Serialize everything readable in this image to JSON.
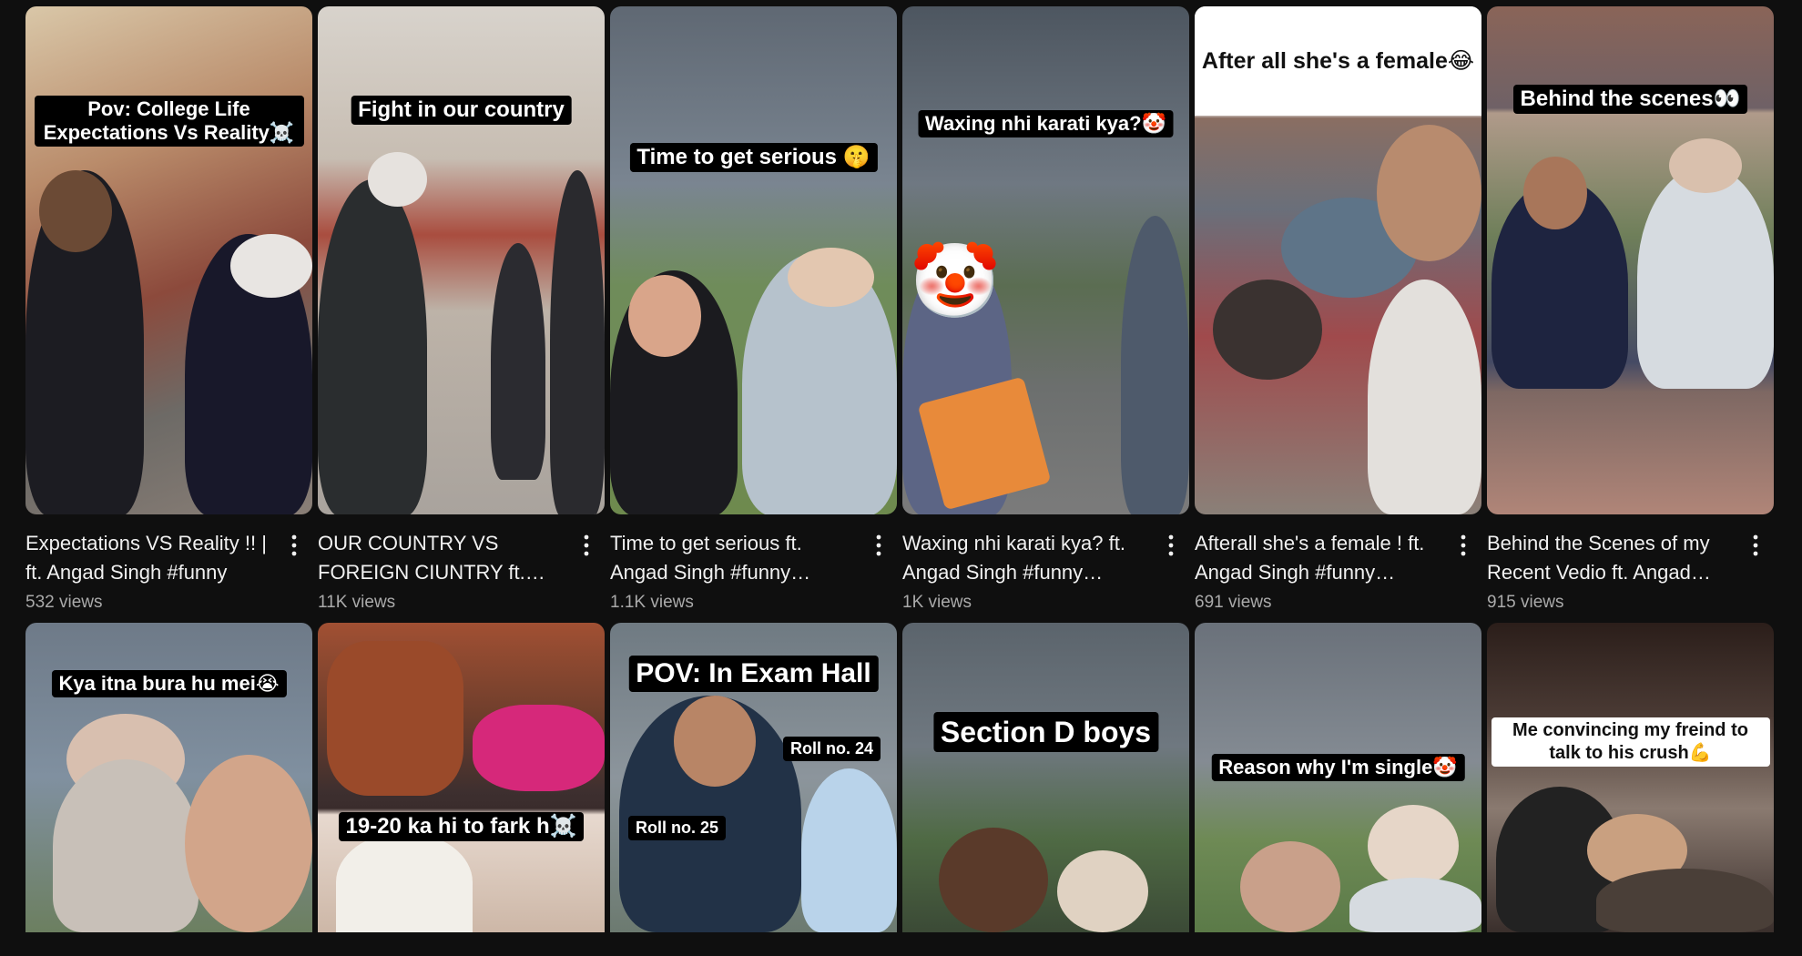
{
  "videos": [
    {
      "title": "Expectations VS Reality !! | ft. Angad Singh  #funny",
      "views": "532 views",
      "caption": "Pov: College Life Expectations Vs Reality☠️"
    },
    {
      "title": "OUR COUNTRY VS FOREIGN CIUNTRY ft. Angad Singh",
      "views": "11K views",
      "caption": "Fight in our country"
    },
    {
      "title": "Time to get serious ft. Angad Singh  #funny #comedy",
      "views": "1.1K views",
      "caption": "Time to get serious 🤫"
    },
    {
      "title": "Waxing nhi karati kya? ft. Angad Singh  #funny #comedy",
      "views": "1K views",
      "caption": "Waxing nhi karati kya?🤡"
    },
    {
      "title": "Afterall she's a female ! ft. Angad Singh  #funny #comedy",
      "views": "691 views",
      "caption": "After all she's a female😂"
    },
    {
      "title": "Behind the Scenes of my Recent Vedio ft. Angad Singh",
      "views": "915 views",
      "caption": "Behind the scenes👀"
    }
  ],
  "row2": [
    {
      "caption": "Kya itna bura hu mei😭"
    },
    {
      "caption": "19-20 ka hi to fark h☠️"
    },
    {
      "caption": "POV: In Exam Hall",
      "tag_a": "Roll no. 24",
      "tag_b": "Roll no. 25"
    },
    {
      "caption": "Section D boys"
    },
    {
      "caption": "Reason why I'm single🤡"
    },
    {
      "caption": "Me convincing my freind to talk to his crush💪"
    }
  ],
  "icons": {
    "more": "more-vert-icon",
    "clown": "🤡"
  },
  "colors": {
    "background": "#0f0f0f",
    "title": "#f1f1f1",
    "meta": "#aaaaaa"
  }
}
